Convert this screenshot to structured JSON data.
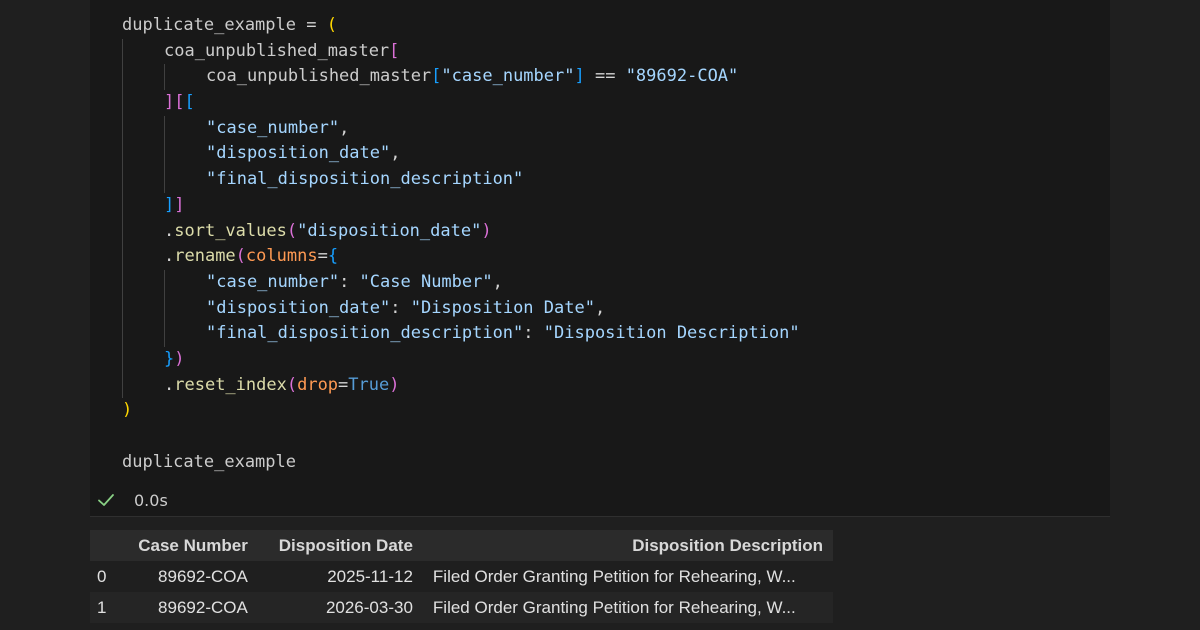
{
  "code": {
    "l1_var": "duplicate_example",
    "l1_eq": " = ",
    "open_paren": "(",
    "df_name": "coa_unpublished_master",
    "df_col_key": "\"case_number\"",
    "eq_op": " == ",
    "case_value": "\"89692-COA\"",
    "col_case_number": "\"case_number\"",
    "col_disposition_date": "\"disposition_date\"",
    "col_final_disp": "\"final_disposition_description\"",
    "sort_method": "sort_values",
    "sort_arg": "\"disposition_date\"",
    "rename_method": "rename",
    "rename_kw": "columns",
    "map1_key": "\"case_number\"",
    "map1_val": "\"Case Number\"",
    "map2_key": "\"disposition_date\"",
    "map2_val": "\"Disposition Date\"",
    "map3_key": "\"final_disposition_description\"",
    "map3_val": "\"Disposition Description\"",
    "reset_method": "reset_index",
    "reset_kw": "drop",
    "reset_val": "True",
    "close_paren": ")",
    "last_line": "duplicate_example"
  },
  "status": {
    "icon": "check-icon",
    "elapsed": "0.0s",
    "color": "#89d185"
  },
  "output_table": {
    "columns": [
      "",
      "Case Number",
      "Disposition Date",
      "Disposition Description"
    ],
    "rows": [
      [
        "0",
        "89692-COA",
        "2025-11-12",
        "Filed Order Granting Petition for Rehearing, W..."
      ],
      [
        "1",
        "89692-COA",
        "2026-03-30",
        "Filed Order Granting Petition for Rehearing, W..."
      ]
    ]
  }
}
